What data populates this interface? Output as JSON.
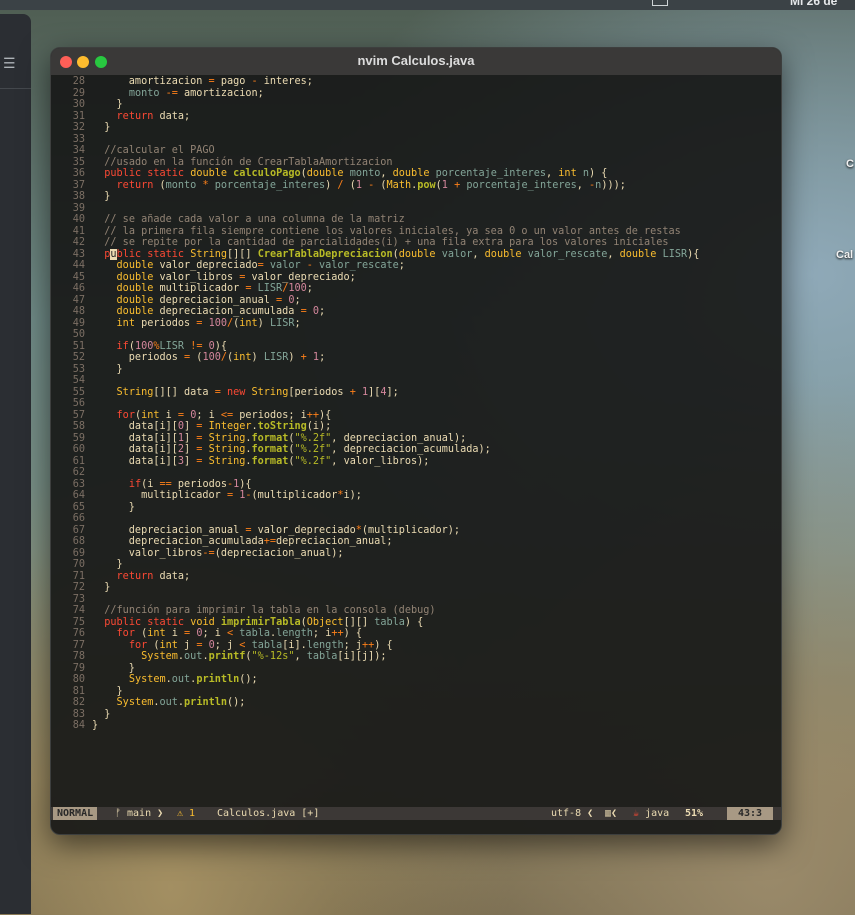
{
  "menubar": {
    "date_text": "Mi 26 de"
  },
  "desktop": {
    "label1": "C",
    "label2": "Cal"
  },
  "bg_window": {
    "menu_icon": "hamburger-icon"
  },
  "window": {
    "title": "nvim Calculos.java"
  },
  "code_lines": [
    {
      "n": "28",
      "html": "      amortizacion <span class='o'>=</span> pago <span class='o'>-</span> interes;"
    },
    {
      "n": "29",
      "html": "      <span class='p'>monto</span> <span class='o'>-=</span> amortizacion;"
    },
    {
      "n": "30",
      "html": "    }"
    },
    {
      "n": "31",
      "html": "    <span class='k'>return</span> data;"
    },
    {
      "n": "32",
      "html": "  }"
    },
    {
      "n": "33",
      "html": ""
    },
    {
      "n": "34",
      "html": "  <span class='c'>//calcular el PAGO</span>"
    },
    {
      "n": "35",
      "html": "  <span class='c'>//usado en la función de CrearTablaAmortizacion</span>"
    },
    {
      "n": "36",
      "html": "  <span class='k'>public</span> <span class='k'>static</span> <span class='t'>double</span> <span class='f'>calculoPago</span>(<span class='t'>double</span> <span class='p'>monto</span>, <span class='t'>double</span> <span class='p'>porcentaje_interes</span>, <span class='t'>int</span> <span class='p'>n</span>) {"
    },
    {
      "n": "37",
      "html": "    <span class='k'>return</span> (<span class='p'>monto</span> <span class='o'>*</span> <span class='p'>porcentaje_interes</span>) <span class='o'>/</span> (<span class='n'>1</span> <span class='o'>-</span> (<span class='t'>Math</span>.<span class='f'>pow</span>(<span class='n'>1</span> <span class='o'>+</span> <span class='p'>porcentaje_interes</span>, <span class='o'>-</span><span class='p'>n</span>)));"
    },
    {
      "n": "38",
      "html": "  }"
    },
    {
      "n": "39",
      "html": ""
    },
    {
      "n": "40",
      "html": "  <span class='c'>// se añade cada valor a una columna de la matriz</span>"
    },
    {
      "n": "41",
      "html": "  <span class='c'>// la primera fila siempre contiene los valores iniciales, ya sea 0 o un valor antes de restas</span>"
    },
    {
      "n": "42",
      "html": "  <span class='c'>// se repite por la cantidad de parcialidades(i) + una fila extra para los valores iniciales</span>"
    },
    {
      "n": "43",
      "html": "  <span class='k'>p</span><span class='cur'>u</span><span class='k'>blic</span> <span class='k'>static</span> <span class='t'>String</span>[][] <span class='f'>CrearTablaDepreciacion</span>(<span class='t'>double</span> <span class='p'>valor</span>, <span class='t'>double</span> <span class='p'>valor_rescate</span>, <span class='t'>double</span> <span class='p'>LISR</span>){"
    },
    {
      "n": "44",
      "html": "    <span class='t'>double</span> valor_depreciado<span class='o'>=</span> <span class='p'>valor</span> <span class='o'>-</span> <span class='p'>valor_rescate</span>;"
    },
    {
      "n": "45",
      "html": "    <span class='t'>double</span> valor_libros <span class='o'>=</span> valor_depreciado;"
    },
    {
      "n": "46",
      "html": "    <span class='t'>double</span> multiplicador <span class='o'>=</span> <span class='p'>LISR</span><span class='o'>/</span><span class='n'>100</span>;"
    },
    {
      "n": "47",
      "html": "    <span class='t'>double</span> depreciacion_anual <span class='o'>=</span> <span class='n'>0</span>;"
    },
    {
      "n": "48",
      "html": "    <span class='t'>double</span> depreciacion_acumulada <span class='o'>=</span> <span class='n'>0</span>;"
    },
    {
      "n": "49",
      "html": "    <span class='t'>int</span> periodos <span class='o'>=</span> <span class='n'>100</span><span class='o'>/</span>(<span class='t'>int</span>) <span class='p'>LISR</span>;"
    },
    {
      "n": "50",
      "html": ""
    },
    {
      "n": "51",
      "html": "    <span class='k'>if</span>(<span class='n'>100</span><span class='o'>%</span><span class='p'>LISR</span> <span class='o'>!=</span> <span class='n'>0</span>){"
    },
    {
      "n": "52",
      "html": "      periodos <span class='o'>=</span> (<span class='n'>100</span><span class='o'>/</span>(<span class='t'>int</span>) <span class='p'>LISR</span>) <span class='o'>+</span> <span class='n'>1</span>;"
    },
    {
      "n": "53",
      "html": "    }"
    },
    {
      "n": "54",
      "html": ""
    },
    {
      "n": "55",
      "html": "    <span class='t'>String</span>[][] data <span class='o'>=</span> <span class='k'>new</span> <span class='t'>String</span>[periodos <span class='o'>+</span> <span class='n'>1</span>][<span class='n'>4</span>];"
    },
    {
      "n": "56",
      "html": ""
    },
    {
      "n": "57",
      "html": "    <span class='k'>for</span>(<span class='t'>int</span> i <span class='o'>=</span> <span class='n'>0</span>; i <span class='o'>&lt;=</span> periodos; i<span class='o'>++</span>){"
    },
    {
      "n": "58",
      "html": "      data[i][<span class='n'>0</span>] <span class='o'>=</span> <span class='t'>Integer</span>.<span class='f'>toString</span>(i);"
    },
    {
      "n": "59",
      "html": "      data[i][<span class='n'>1</span>] <span class='o'>=</span> <span class='t'>String</span>.<span class='f'>format</span>(<span class='s'>\"%.2f\"</span>, depreciacion_anual);"
    },
    {
      "n": "60",
      "html": "      data[i][<span class='n'>2</span>] <span class='o'>=</span> <span class='t'>String</span>.<span class='f'>format</span>(<span class='s'>\"%.2f\"</span>, depreciacion_acumulada);"
    },
    {
      "n": "61",
      "html": "      data[i][<span class='n'>3</span>] <span class='o'>=</span> <span class='t'>String</span>.<span class='f'>format</span>(<span class='s'>\"%.2f\"</span>, valor_libros);"
    },
    {
      "n": "62",
      "html": ""
    },
    {
      "n": "63",
      "html": "      <span class='k'>if</span>(i <span class='o'>==</span> periodos<span class='o'>-</span><span class='n'>1</span>){"
    },
    {
      "n": "64",
      "html": "        multiplicador <span class='o'>=</span> <span class='n'>1</span><span class='o'>-</span>(multiplicador<span class='o'>*</span>i);"
    },
    {
      "n": "65",
      "html": "      }"
    },
    {
      "n": "66",
      "html": ""
    },
    {
      "n": "67",
      "html": "      depreciacion_anual <span class='o'>=</span> valor_depreciado<span class='o'>*</span>(multiplicador);"
    },
    {
      "n": "68",
      "html": "      depreciacion_acumulada<span class='o'>+=</span>depreciacion_anual;"
    },
    {
      "n": "69",
      "html": "      valor_libros<span class='o'>-=</span>(depreciacion_anual);"
    },
    {
      "n": "70",
      "html": "    }"
    },
    {
      "n": "71",
      "html": "    <span class='k'>return</span> data;"
    },
    {
      "n": "72",
      "html": "  }"
    },
    {
      "n": "73",
      "html": ""
    },
    {
      "n": "74",
      "html": "  <span class='c'>//función para imprimir la tabla en la consola (debug)</span>"
    },
    {
      "n": "75",
      "html": "  <span class='k'>public</span> <span class='k'>static</span> <span class='t'>void</span> <span class='f'>imprimirTabla</span>(<span class='t'>Object</span>[][] <span class='p'>tabla</span>) {"
    },
    {
      "n": "76",
      "html": "    <span class='k'>for</span> (<span class='t'>int</span> i <span class='o'>=</span> <span class='n'>0</span>; i <span class='o'>&lt;</span> <span class='p'>tabla</span>.<span class='p'>length</span>; i<span class='o'>++</span>) {"
    },
    {
      "n": "77",
      "html": "      <span class='k'>for</span> (<span class='t'>int</span> j <span class='o'>=</span> <span class='n'>0</span>; j <span class='o'>&lt;</span> <span class='p'>tabla</span>[i].<span class='p'>length</span>; j<span class='o'>++</span>) {"
    },
    {
      "n": "78",
      "html": "        <span class='t'>System</span>.<span class='p'>out</span>.<span class='f'>printf</span>(<span class='s'>\"%-12s\"</span>, <span class='p'>tabla</span>[i][j]);"
    },
    {
      "n": "79",
      "html": "      }"
    },
    {
      "n": "80",
      "html": "      <span class='t'>System</span>.<span class='p'>out</span>.<span class='f'>println</span>();"
    },
    {
      "n": "81",
      "html": "    }"
    },
    {
      "n": "82",
      "html": "    <span class='t'>System</span>.<span class='p'>out</span>.<span class='f'>println</span>();"
    },
    {
      "n": "83",
      "html": "  }"
    },
    {
      "n": "84",
      "html": "}"
    }
  ],
  "statusline": {
    "mode": "NORMAL",
    "branch": "ᚠ main ❯",
    "warnings": "⚠ 1",
    "file": "Calculos.java [+]",
    "encoding": "utf-8 ❮",
    "os_icon": "apple-icon",
    "os_text": "▥❮",
    "lang_icon": "java-icon",
    "lang_glyph": "☕",
    "language": "java",
    "percent": "51%",
    "position": "43:3"
  }
}
